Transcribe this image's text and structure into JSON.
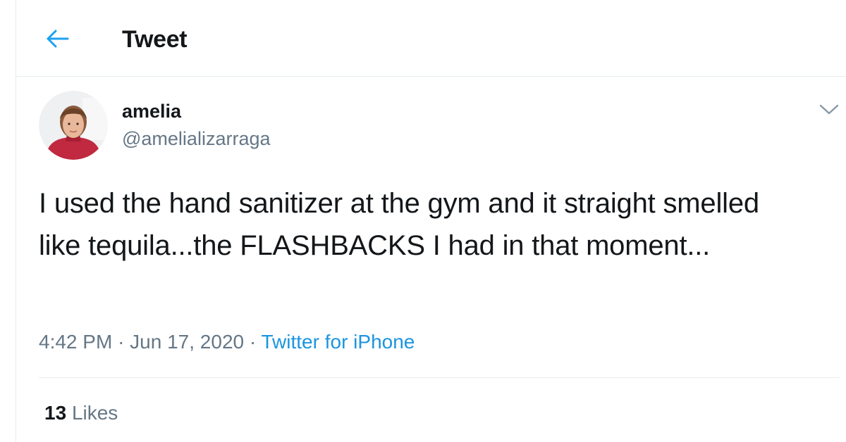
{
  "header": {
    "title": "Tweet",
    "back_icon": "arrow-left-icon"
  },
  "tweet": {
    "author": {
      "display_name": "amelia",
      "handle": "@amelializarraga",
      "avatar_icon": "profile-photo"
    },
    "menu_icon": "chevron-down-icon",
    "text": "I used the hand sanitizer at the gym and it straight smelled like tequila...the FLASHBACKS I had in that moment...",
    "time": "4:42 PM",
    "separator": "·",
    "date": "Jun 17, 2020",
    "source": "Twitter for iPhone",
    "likes": {
      "count": "13",
      "label": "Likes"
    }
  },
  "colors": {
    "accent": "#1b95e0",
    "text_primary": "#14171a",
    "text_secondary": "#657786",
    "border": "#e6ecf0"
  }
}
